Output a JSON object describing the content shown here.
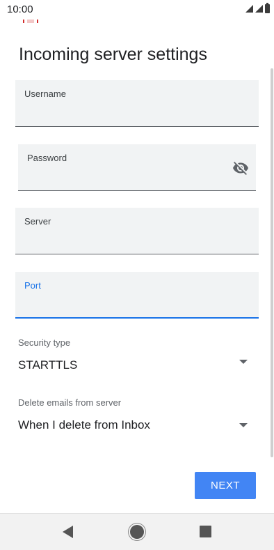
{
  "status_bar": {
    "time": "10:00"
  },
  "page": {
    "title": "Incoming server settings"
  },
  "fields": {
    "username": {
      "label": "Username",
      "value": ""
    },
    "password": {
      "label": "Password",
      "value": ""
    },
    "server": {
      "label": "Server",
      "value": ""
    },
    "port": {
      "label": "Port",
      "value": ""
    }
  },
  "security": {
    "label": "Security type",
    "value": "STARTTLS"
  },
  "delete_policy": {
    "label": "Delete emails from server",
    "value": "When I delete from Inbox"
  },
  "actions": {
    "next_label": "NEXT"
  },
  "icons": {
    "visibility": "visibility-off-icon",
    "back": "back-icon",
    "home": "home-icon",
    "recents": "recents-icon"
  },
  "colors": {
    "accent": "#1a73e8",
    "button": "#4285f4"
  }
}
